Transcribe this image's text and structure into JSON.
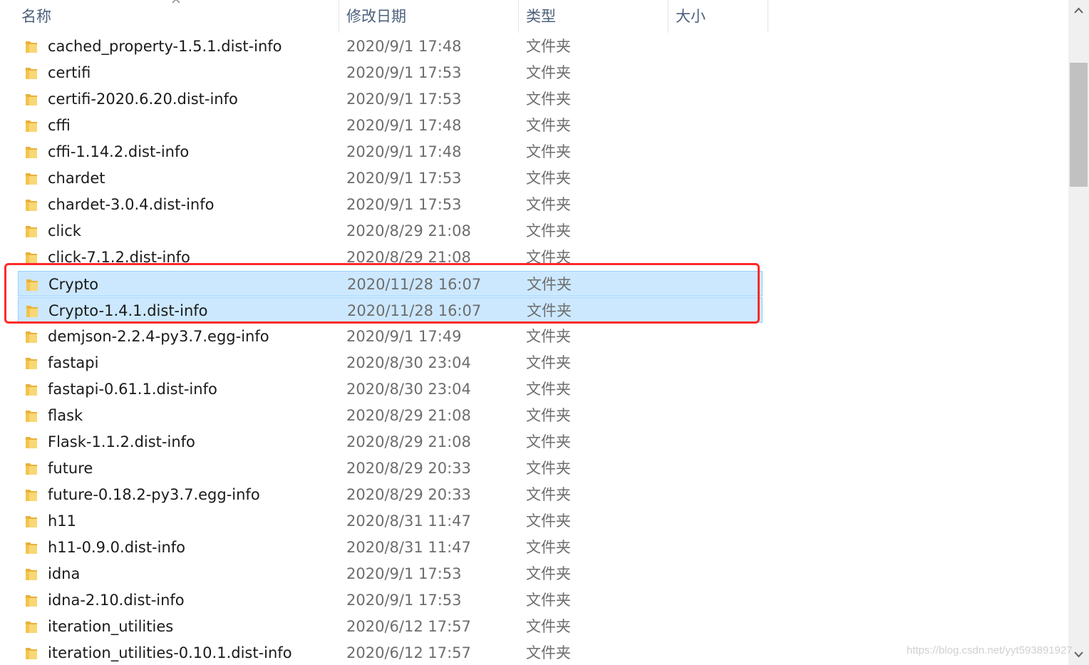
{
  "columns": {
    "name": "名称",
    "date": "修改日期",
    "type": "类型",
    "size": "大小"
  },
  "sort_icon": "chevron-up-icon",
  "rows": [
    {
      "name": "cached_property-1.5.1.dist-info",
      "date": "2020/9/1 17:48",
      "type": "文件夹"
    },
    {
      "name": "certifi",
      "date": "2020/9/1 17:53",
      "type": "文件夹"
    },
    {
      "name": "certifi-2020.6.20.dist-info",
      "date": "2020/9/1 17:53",
      "type": "文件夹"
    },
    {
      "name": "cffi",
      "date": "2020/9/1 17:48",
      "type": "文件夹"
    },
    {
      "name": "cffi-1.14.2.dist-info",
      "date": "2020/9/1 17:48",
      "type": "文件夹"
    },
    {
      "name": "chardet",
      "date": "2020/9/1 17:53",
      "type": "文件夹"
    },
    {
      "name": "chardet-3.0.4.dist-info",
      "date": "2020/9/1 17:53",
      "type": "文件夹"
    },
    {
      "name": "click",
      "date": "2020/8/29 21:08",
      "type": "文件夹"
    },
    {
      "name": "click-7.1.2.dist-info",
      "date": "2020/8/29 21:08",
      "type": "文件夹"
    },
    {
      "name": "Crypto",
      "date": "2020/11/28 16:07",
      "type": "文件夹",
      "selected": true
    },
    {
      "name": "Crypto-1.4.1.dist-info",
      "date": "2020/11/28 16:07",
      "type": "文件夹",
      "selected": true
    },
    {
      "name": "demjson-2.2.4-py3.7.egg-info",
      "date": "2020/9/1 17:49",
      "type": "文件夹"
    },
    {
      "name": "fastapi",
      "date": "2020/8/30 23:04",
      "type": "文件夹"
    },
    {
      "name": "fastapi-0.61.1.dist-info",
      "date": "2020/8/30 23:04",
      "type": "文件夹"
    },
    {
      "name": "flask",
      "date": "2020/8/29 21:08",
      "type": "文件夹"
    },
    {
      "name": "Flask-1.1.2.dist-info",
      "date": "2020/8/29 21:08",
      "type": "文件夹"
    },
    {
      "name": "future",
      "date": "2020/8/29 20:33",
      "type": "文件夹"
    },
    {
      "name": "future-0.18.2-py3.7.egg-info",
      "date": "2020/8/29 20:33",
      "type": "文件夹"
    },
    {
      "name": "h11",
      "date": "2020/8/31 11:47",
      "type": "文件夹"
    },
    {
      "name": "h11-0.9.0.dist-info",
      "date": "2020/8/31 11:47",
      "type": "文件夹"
    },
    {
      "name": "idna",
      "date": "2020/9/1 17:53",
      "type": "文件夹"
    },
    {
      "name": "idna-2.10.dist-info",
      "date": "2020/9/1 17:53",
      "type": "文件夹"
    },
    {
      "name": "iteration_utilities",
      "date": "2020/6/12 17:57",
      "type": "文件夹"
    },
    {
      "name": "iteration_utilities-0.10.1.dist-info",
      "date": "2020/6/12 17:57",
      "type": "文件夹"
    }
  ],
  "watermark": "https://blog.csdn.net/yyt593891927",
  "colors": {
    "selection": "#cce8ff",
    "selection_border": "#99d1ff",
    "highlight": "#ff2a2a",
    "folder": "#f4c44e"
  }
}
